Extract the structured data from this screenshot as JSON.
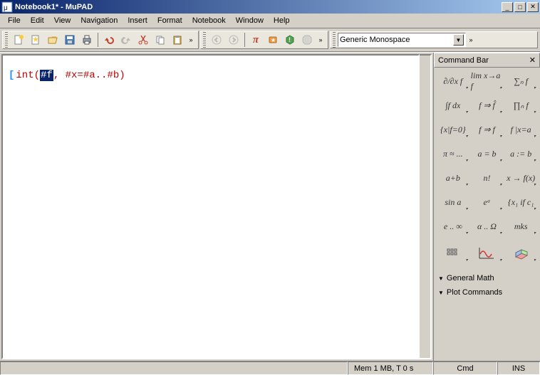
{
  "window": {
    "title": "Notebook1* - MuPAD"
  },
  "menu": {
    "items": [
      "File",
      "Edit",
      "View",
      "Navigation",
      "Insert",
      "Format",
      "Notebook",
      "Window",
      "Help"
    ]
  },
  "toolbar1_icons": [
    "new-notebook",
    "new-star",
    "open",
    "save",
    "print",
    "sep",
    "undo",
    "redo",
    "cut",
    "copy",
    "paste",
    "sep",
    "back",
    "forward",
    "sep",
    "pi",
    "debug1",
    "debug2",
    "stop"
  ],
  "font_dropdown": {
    "value": "Generic Monospace"
  },
  "editor": {
    "code": {
      "prefix": "int(",
      "selected": "#f",
      "mid": ", #x=#a..#b",
      "suffix": ")"
    }
  },
  "sidebar": {
    "title": "Command Bar",
    "palette_labels": [
      "∂/∂x f",
      "lim x→a f",
      "∑ₙ f",
      "∫f dx",
      "f ⇒ f̂",
      "∏ₙ f",
      "{x|f=0}",
      "f ⇒ f",
      "f |x=a",
      "π ≈ ...",
      "a = b",
      "a := b",
      "a+b",
      "n!",
      "x → f(x)",
      "sin a",
      "eᵃ",
      "{x₁ if c₁",
      "e .. ∞",
      "α .. Ω",
      "mks"
    ],
    "palette_icons": [
      "matrix",
      "plot2d",
      "plot3d"
    ],
    "sections": [
      "General Math",
      "Plot Commands"
    ]
  },
  "status": {
    "memory": "Mem 1 MB, T 0 s",
    "mode": "Cmd",
    "ins": "INS"
  }
}
